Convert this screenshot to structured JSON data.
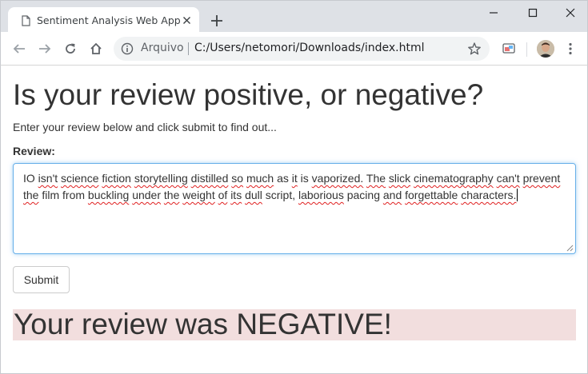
{
  "browser": {
    "tab_title": "Sentiment Analysis Web App",
    "origin_chip": "Arquivo",
    "url": "C:/Users/netomori/Downloads/index.html"
  },
  "page": {
    "headline": "Is your review positive, or negative?",
    "intro": "Enter your review below and click submit to find out...",
    "review_label": "Review:",
    "review_text": "IO isn't science fiction storytelling distilled so much as it is vaporized. The slick cinematography can't prevent the film from buckling under the weight of its dull script, laborious pacing and forgettable characters.",
    "submit_label": "Submit",
    "result": "Your review was NEGATIVE!"
  },
  "icons": [
    "page-icon",
    "close-icon",
    "new-tab-icon",
    "minimize-icon",
    "maximize-icon",
    "window-close-icon",
    "back-icon",
    "forward-icon",
    "reload-icon",
    "home-icon",
    "info-icon",
    "star-icon",
    "extension-icon",
    "avatar",
    "menu-icon"
  ],
  "colors": {
    "result_background": "#f2dede",
    "focus_border": "#66afe9",
    "spellcheck_underline": "#e02020"
  }
}
